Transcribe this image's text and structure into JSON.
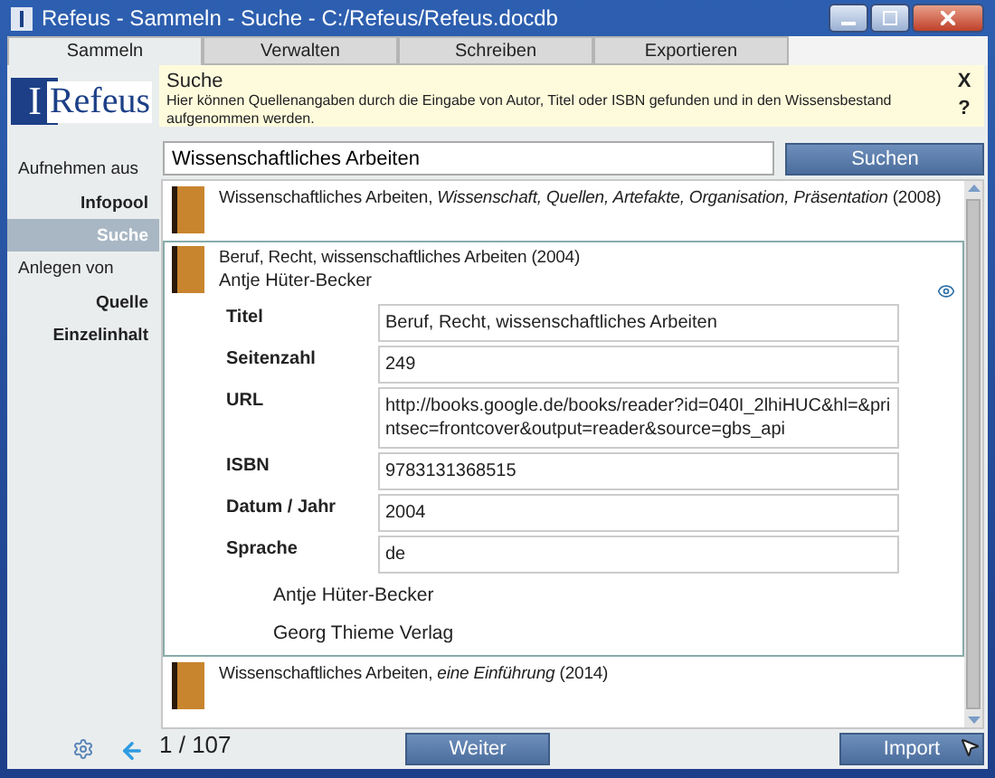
{
  "window": {
    "title": "Refeus - Sammeln - Suche - C:/Refeus/Refeus.docdb"
  },
  "tabs": [
    {
      "label": "Sammeln",
      "selected": true
    },
    {
      "label": "Verwalten",
      "selected": false
    },
    {
      "label": "Schreiben",
      "selected": false
    },
    {
      "label": "Exportieren",
      "selected": false
    }
  ],
  "logo": {
    "letter": "I",
    "text": "Refeus"
  },
  "sidebar": {
    "sections": [
      {
        "label": "Aufnehmen aus",
        "items": [
          {
            "label": "Infopool",
            "selected": false
          },
          {
            "label": "Suche",
            "selected": true
          }
        ]
      },
      {
        "label": "Anlegen von",
        "items": [
          {
            "label": "Quelle",
            "selected": false
          },
          {
            "label": "Einzelinhalt",
            "selected": false
          }
        ]
      }
    ]
  },
  "info": {
    "title": "Suche",
    "text": "Hier können Quellenangaben durch die Eingabe von Autor, Titel oder ISBN gefunden und in den Wissensbestand aufgenommen werden.",
    "close": "X",
    "help": "?"
  },
  "search": {
    "value": "Wissenschaftliches Arbeiten",
    "button": "Suchen"
  },
  "results": [
    {
      "title": "Wissenschaftliches Arbeiten, *Wissenschaft, Quellen, Artefakte, Organisation, Präsentation* (2008)",
      "expanded": false
    },
    {
      "title": "Beruf, Recht, wissenschaftliches Arbeiten (2004)",
      "author": "Antje Hüter-Becker",
      "expanded": true,
      "fields": [
        {
          "label": "Titel",
          "value": "Beruf, Recht, wissenschaftliches Arbeiten"
        },
        {
          "label": "Seitenzahl",
          "value": "249"
        },
        {
          "label": "URL",
          "value": "http://books.google.de/books/reader?id=040I_2lhiHUC&hl=&printsec=frontcover&output=reader&source=gbs_api"
        },
        {
          "label": "ISBN",
          "value": "9783131368515"
        },
        {
          "label": "Datum / Jahr",
          "value": "2004"
        },
        {
          "label": "Sprache",
          "value": "de"
        }
      ],
      "extra": [
        "Antje Hüter-Becker",
        "Georg Thieme Verlag"
      ]
    },
    {
      "title": "Wissenschaftliches Arbeiten, *eine Einführung* (2014)",
      "expanded": false
    }
  ],
  "footer": {
    "counter": "1 / 107",
    "next": "Weiter",
    "import": "Import"
  }
}
